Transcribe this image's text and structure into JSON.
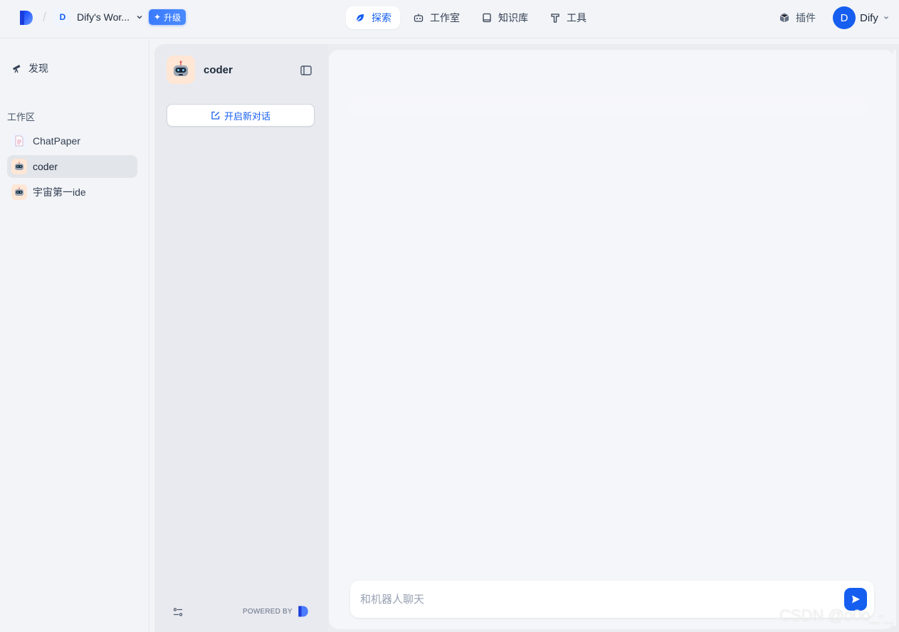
{
  "header": {
    "workspace_initial": "D",
    "workspace_name": "Dify's Wor...",
    "upgrade_label": "升级",
    "nav": [
      {
        "label": "探索",
        "icon": "explore-icon",
        "active": true
      },
      {
        "label": "工作室",
        "icon": "robot-icon",
        "active": false
      },
      {
        "label": "知识库",
        "icon": "book-icon",
        "active": false
      },
      {
        "label": "工具",
        "icon": "hammer-icon",
        "active": false
      }
    ],
    "plugin_label": "插件",
    "user_initial": "D",
    "user_name": "Dify"
  },
  "sidebar": {
    "discover_label": "发现",
    "section_label": "工作区",
    "apps": [
      {
        "label": "ChatPaper",
        "icon": "document-icon",
        "active": false
      },
      {
        "label": "coder",
        "icon": "robot-avatar-icon",
        "active": true
      },
      {
        "label": "宇宙第一ide",
        "icon": "robot-avatar-icon",
        "active": false
      }
    ]
  },
  "conversation": {
    "app_name": "coder",
    "new_chat_label": "开启新对话",
    "powered_by": "POWERED BY"
  },
  "chat": {
    "input_placeholder": "和机器人聊天"
  },
  "watermark": "CSDN @o0o_-_",
  "colors": {
    "accent": "#155eef",
    "background": "#f2f4f7",
    "avatar_bg": "#ffe6d5"
  }
}
